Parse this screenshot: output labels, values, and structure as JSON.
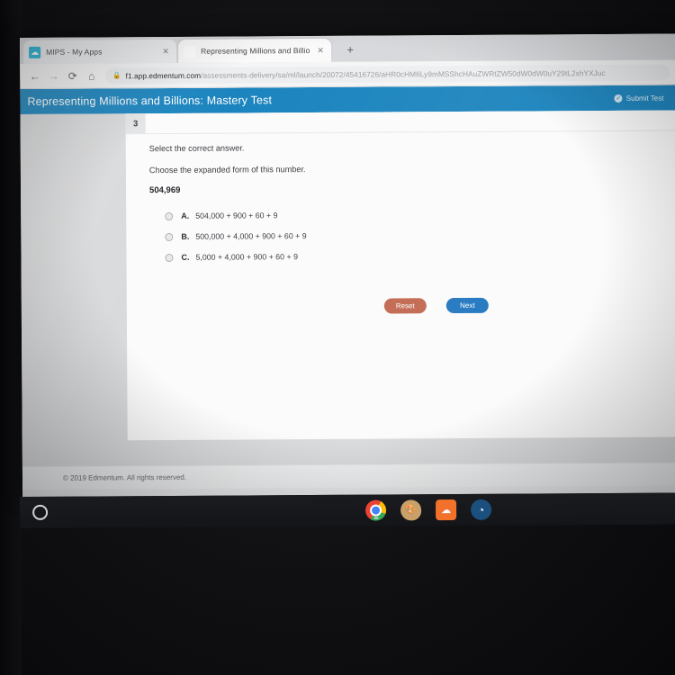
{
  "browser": {
    "tabs": [
      {
        "title": "MIPS - My Apps",
        "favicon": "mips-cloud-icon",
        "active": false,
        "close_label": "✕"
      },
      {
        "title": "Representing Millions and Billio",
        "favicon": "edmentum-e-icon",
        "active": true,
        "close_label": "✕"
      }
    ],
    "new_tab_label": "+",
    "nav": {
      "back": "←",
      "forward": "→",
      "reload": "⟳",
      "home": "⌂"
    },
    "omnibox": {
      "lock_icon": "🔒",
      "host": "f1.app.edmentum.com",
      "path": "/assessments-delivery/sa/ml/launch/20072/45416726/aHR0cHM6Ly9mMSShcHAuZWRtZW50dW0dW0uY29tL2xhYXJuc"
    }
  },
  "app_header": {
    "title": "Representing Millions and Billions: Mastery Test",
    "submit_label": "Submit Test",
    "submit_icon": "check-circle-icon",
    "accent_color": "#1b84be"
  },
  "question": {
    "number": "3",
    "prompt": "Select the correct answer.",
    "stem": "Choose the expanded form of this number.",
    "value": "504,969",
    "options": [
      {
        "letter": "A.",
        "text": "504,000 + 900 + 60 + 9",
        "selected": false
      },
      {
        "letter": "B.",
        "text": "500,000 + 4,000 + 900 + 60 + 9",
        "selected": false
      },
      {
        "letter": "C.",
        "text": "5,000 + 4,000 + 900 + 60 + 9",
        "selected": false
      }
    ]
  },
  "actions": {
    "reset_label": "Reset",
    "reset_color": "#c1674f",
    "next_label": "Next",
    "next_color": "#2277c0"
  },
  "footer": {
    "copyright": "© 2019 Edmentum. All rights reserved."
  },
  "shelf": {
    "launcher_name": "launcher-circle-icon",
    "icons": [
      {
        "name": "chrome-icon",
        "glyph": ""
      },
      {
        "name": "paint-palette-icon",
        "glyph": "🎨"
      },
      {
        "name": "cloud-icon",
        "glyph": "☁"
      },
      {
        "name": "wifi-globe-icon",
        "glyph": "◔"
      }
    ]
  }
}
